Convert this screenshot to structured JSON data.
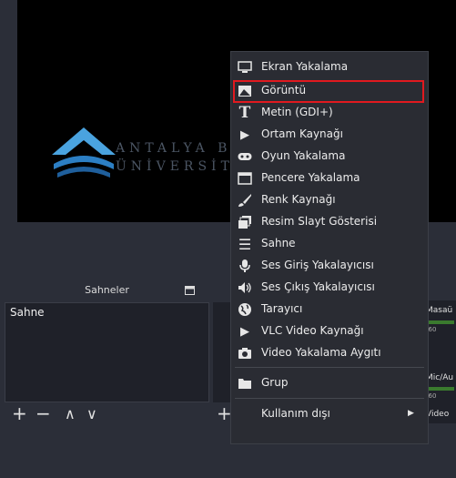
{
  "preview": {
    "logo_line1": "ANTALYA BİL",
    "logo_line2": "ÜNİVERSİTE"
  },
  "scenes": {
    "header": "Sahneler",
    "items": [
      "Sahne"
    ],
    "toolbar": {
      "add": "+",
      "remove": "−",
      "up": "∧",
      "down": "∨"
    }
  },
  "mixer": {
    "channels": [
      {
        "label": "Masaü",
        "scale": "-60"
      },
      {
        "label": "Mic/Au",
        "scale": "-60"
      },
      {
        "label": "Video"
      }
    ]
  },
  "context_menu": {
    "items": [
      {
        "label": "Ekran Yakalama",
        "icon": "monitor-icon"
      },
      {
        "label": "Görüntü",
        "icon": "image-icon",
        "highlighted": true
      },
      {
        "label": "Metin (GDI+)",
        "icon": "text-icon"
      },
      {
        "label": "Ortam Kaynağı",
        "icon": "play-icon"
      },
      {
        "label": "Oyun Yakalama",
        "icon": "gamepad-icon"
      },
      {
        "label": "Pencere Yakalama",
        "icon": "window-icon"
      },
      {
        "label": "Renk Kaynağı",
        "icon": "brush-icon"
      },
      {
        "label": "Resim Slayt Gösterisi",
        "icon": "slideshow-icon"
      },
      {
        "label": "Sahne",
        "icon": "list-icon"
      },
      {
        "label": "Ses Giriş Yakalayıcısı",
        "icon": "microphone-icon"
      },
      {
        "label": "Ses Çıkış Yakalayıcısı",
        "icon": "speaker-icon"
      },
      {
        "label": "Tarayıcı",
        "icon": "globe-icon"
      },
      {
        "label": "VLC Video Kaynağı",
        "icon": "play-icon"
      },
      {
        "label": "Video Yakalama Aygıtı",
        "icon": "camera-icon"
      },
      {
        "label": "Grup",
        "icon": "folder-icon"
      },
      {
        "label": "Kullanım dışı",
        "icon": "",
        "submenu": true
      }
    ]
  },
  "colors": {
    "highlight": "#e0191f",
    "menu_bg": "#2a2c33",
    "logo_blue": "#2c7fc4"
  }
}
